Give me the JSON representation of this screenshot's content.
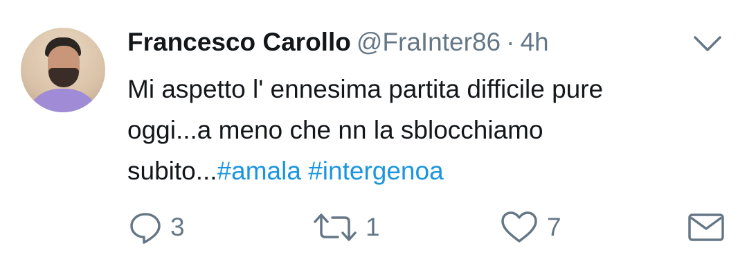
{
  "tweet": {
    "author_name": "Francesco Carollo",
    "handle": "@FraInter86",
    "separator": "·",
    "time": "4h",
    "text_line1": "Mi aspetto l' ennesima partita difficile pure",
    "text_line2": "oggi...a meno che nn la sblocchiamo",
    "text_line3_prefix": "subito...",
    "hashtag1": "#amala",
    "hashtag2": "#intergenoa",
    "reply_count": "3",
    "retweet_count": "1",
    "like_count": "7"
  },
  "colors": {
    "text": "#14171a",
    "muted": "#657786",
    "link": "#1b95e0"
  },
  "icons": [
    "chevron-down-icon",
    "reply-icon",
    "retweet-icon",
    "heart-icon",
    "envelope-icon"
  ]
}
